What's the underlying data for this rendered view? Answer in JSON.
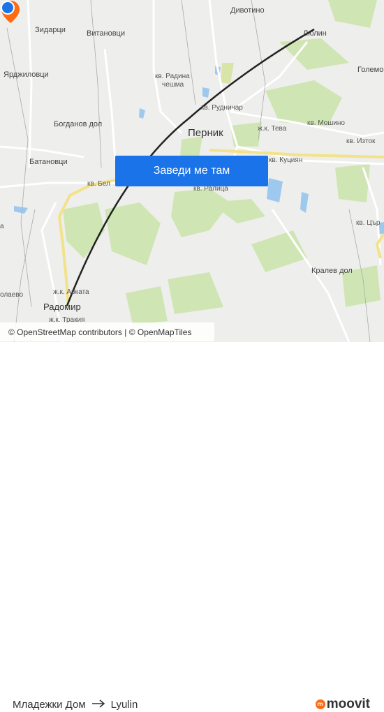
{
  "map": {
    "labels": {
      "divotino": "Дивотино",
      "zidartsi": "Зидарци",
      "vitanovtsi": "Витановци",
      "lyulin_map": "Люлин",
      "golemo": "Големо",
      "yardzhilovtsi": "Ярджиловци",
      "radina_line1": "кв. Радина",
      "radina_line2": "чешма",
      "rudnichar": "кв. Рудничар",
      "bogdanov_dol": "Богданов дол",
      "pernik": "Перник",
      "teva": "ж.к. Тева",
      "moshino": "кв. Мошино",
      "iztok": "кв. Изток",
      "batanovtsi": "Батановци",
      "kutsiyan": "кв. Куциян",
      "bela": "кв. Бел",
      "ralitsa": "кв. Ралица",
      "tsar": "кв. Цър",
      "kralev_dol": "Кралев дол",
      "arkata": "ж.к. Арката",
      "radomir": "Радомир",
      "trakia": "ж.к. Тракия",
      "olaevo": "олаево",
      "left_a": "а"
    },
    "cta_label": "Заведи ме там",
    "attribution": "© OpenStreetMap contributors | © OpenMapTiles",
    "route_color": "#222222",
    "origin_color": "#1a73e8",
    "destination_color": "#ff6a13"
  },
  "footer": {
    "origin": "Младежки Дом",
    "destination": "Lyulin",
    "brand": "moovit",
    "brand_color": "#ff6a13"
  }
}
